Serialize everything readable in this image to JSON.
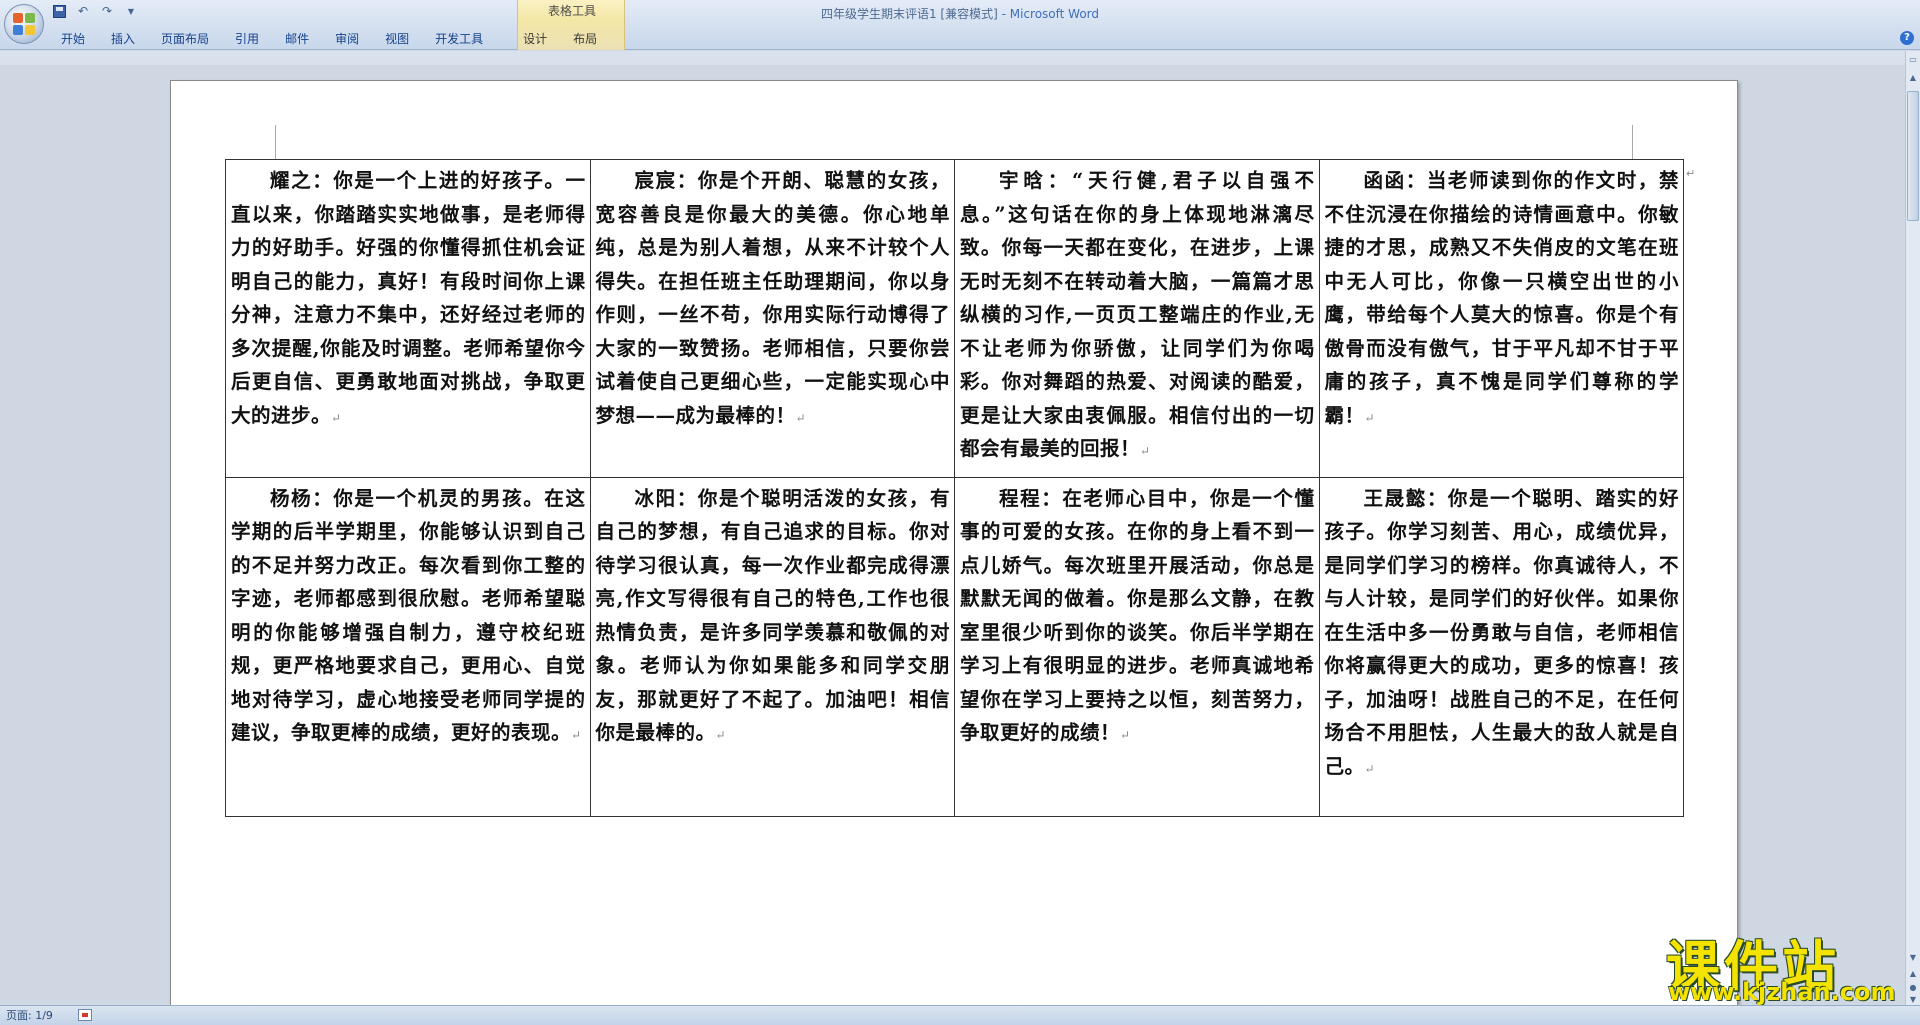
{
  "window": {
    "title": "四年级学生期末评语1 [兼容模式]",
    "app": " - Microsoft Word",
    "context_group": "表格工具"
  },
  "quick_access": {
    "save_icon": "save-icon",
    "undo_icon": "undo-icon",
    "redo_icon": "redo-icon",
    "customize_icon": "chevron-down-icon"
  },
  "ribbon": {
    "tabs": [
      "开始",
      "插入",
      "页面布局",
      "引用",
      "邮件",
      "审阅",
      "视图",
      "开发工具",
      "设计",
      "布局"
    ]
  },
  "document": {
    "rows": [
      [
        "耀之：你是一个上进的好孩子。一直以来，你踏踏实实地做事，是老师得力的好助手。好强的你懂得抓住机会证明自己的能力，真好！有段时间你上课分神，注意力不集中，还好经过老师的多次提醒,你能及时调整。老师希望你今后更自信、更勇敢地面对挑战，争取更大的进步。",
        "宸宸：你是个开朗、聪慧的女孩，宽容善良是你最大的美德。你心地单纯，总是为别人着想，从来不计较个人得失。在担任班主任助理期间，你以身作则，一丝不苟，你用实际行动博得了大家的一致赞扬。老师相信，只要你尝试着使自己更细心些，一定能实现心中梦想——成为最棒的！",
        "宇晗：“天行健,君子以自强不息。”这句话在你的身上体现地淋漓尽致。你每一天都在变化，在进步，上课无时无刻不在转动着大脑，一篇篇才思纵横的习作,一页页工整端庄的作业,无不让老师为你骄傲，让同学们为你喝彩。你对舞蹈的热爱、对阅读的酷爱，更是让大家由衷佩服。相信付出的一切都会有最美的回报！",
        "函函：当老师读到你的作文时，禁不住沉浸在你描绘的诗情画意中。你敏捷的才思，成熟又不失俏皮的文笔在班中无人可比，你像一只横空出世的小鹰，带给每个人莫大的惊喜。你是个有傲骨而没有傲气，甘于平凡却不甘于平庸的孩子，真不愧是同学们尊称的学霸！"
      ],
      [
        "杨杨：你是一个机灵的男孩。在这学期的后半学期里，你能够认识到自己的不足并努力改正。每次看到你工整的字迹，老师都感到很欣慰。老师希望聪明的你能够增强自制力，遵守校纪班规，更严格地要求自己，更用心、自觉地对待学习，虚心地接受老师同学提的建议，争取更棒的成绩，更好的表现。",
        "冰阳：你是个聪明活泼的女孩，有自己的梦想，有自己追求的目标。你对待学习很认真，每一次作业都完成得漂亮,作文写得很有自己的特色,工作也很热情负责，是许多同学羡慕和敬佩的对象。老师认为你如果能多和同学交朋友，那就更好了不起了。加油吧！相信你是最棒的。",
        "程程：在老师心目中，你是一个懂事的可爱的女孩。在你的身上看不到一点儿娇气。每次班里开展活动，你总是默默无闻的做着。你是那么文静，在教室里很少听到你的谈笑。你后半学期在学习上有很明显的进步。老师真诚地希望你在学习上要持之以恒，刻苦努力，争取更好的成绩！",
        "王晟懿：你是一个聪明、踏实的好孩子。你学习刻苦、用心，成绩优异，是同学们学习的榜样。你真诚待人，不与人计较，是同学们的好伙伴。如果你在生活中多一份勇敢与自信，老师相信你将赢得更大的成功，更多的惊喜！孩子，加油呀！战胜自己的不足，在任何场合不用胆怯，人生最大的敌人就是自己。"
      ]
    ],
    "para_mark": "↵"
  },
  "status": {
    "page": "页面: 1/9",
    "proofing_icon": "proofing-icon"
  },
  "watermark": {
    "name": "课件站",
    "url": "www.kjzhan.com"
  }
}
